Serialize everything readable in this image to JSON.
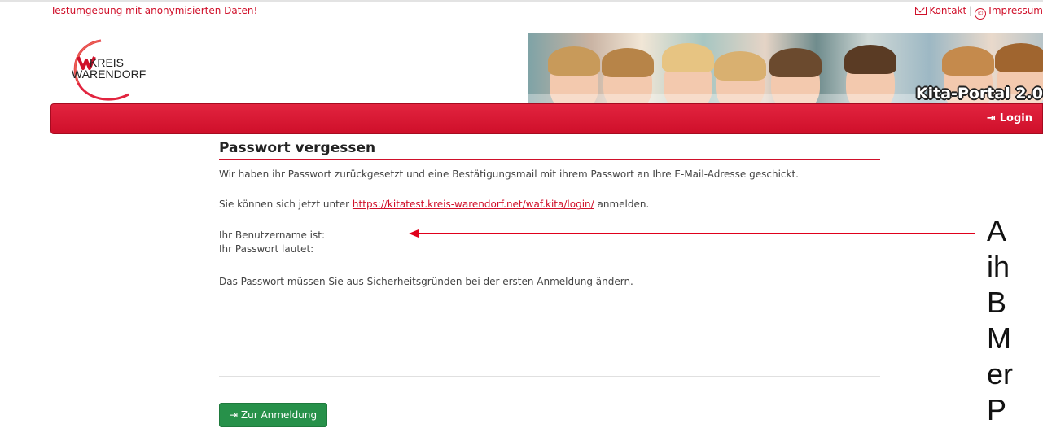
{
  "top": {
    "test_banner": "Testumgebung mit anonymisierten Daten!",
    "contact_label": "Kontakt",
    "separator": "|",
    "imprint_label": "Impressum",
    "icons": [
      "mail-icon",
      "copyright-icon"
    ]
  },
  "brand": {
    "logo_line1": "KREIS",
    "logo_line2": "WARENDORF",
    "hero_title": "Kita-Portal 2.0"
  },
  "nav": {
    "login_label": "Login",
    "login_icon": "sign-in-icon"
  },
  "main": {
    "title": "Passwort vergessen",
    "p1": "Wir haben ihr Passwort zurückgesetzt und eine Bestätigungsmail mit ihrem Passwort an Ihre E-Mail-Adresse geschickt.",
    "p2_prefix": "Sie können sich jetzt unter ",
    "p2_link": "https://kitatest.kreis-warendorf.net/waf.kita/login/",
    "p2_suffix": " anmelden.",
    "username_label": "Ihr Benutzername ist:",
    "password_label": "Ihr Passwort lautet:",
    "p3": "Das Passwort müssen Sie aus Sicherheitsgründen bei der ersten Anmeldung ändern.",
    "button_label": "Zur Anmeldung"
  },
  "annotation": {
    "text": "A\nih\nB\nM\ner\nP"
  },
  "colors": {
    "accent_red": "#d0112b",
    "button_green": "#27914a"
  }
}
